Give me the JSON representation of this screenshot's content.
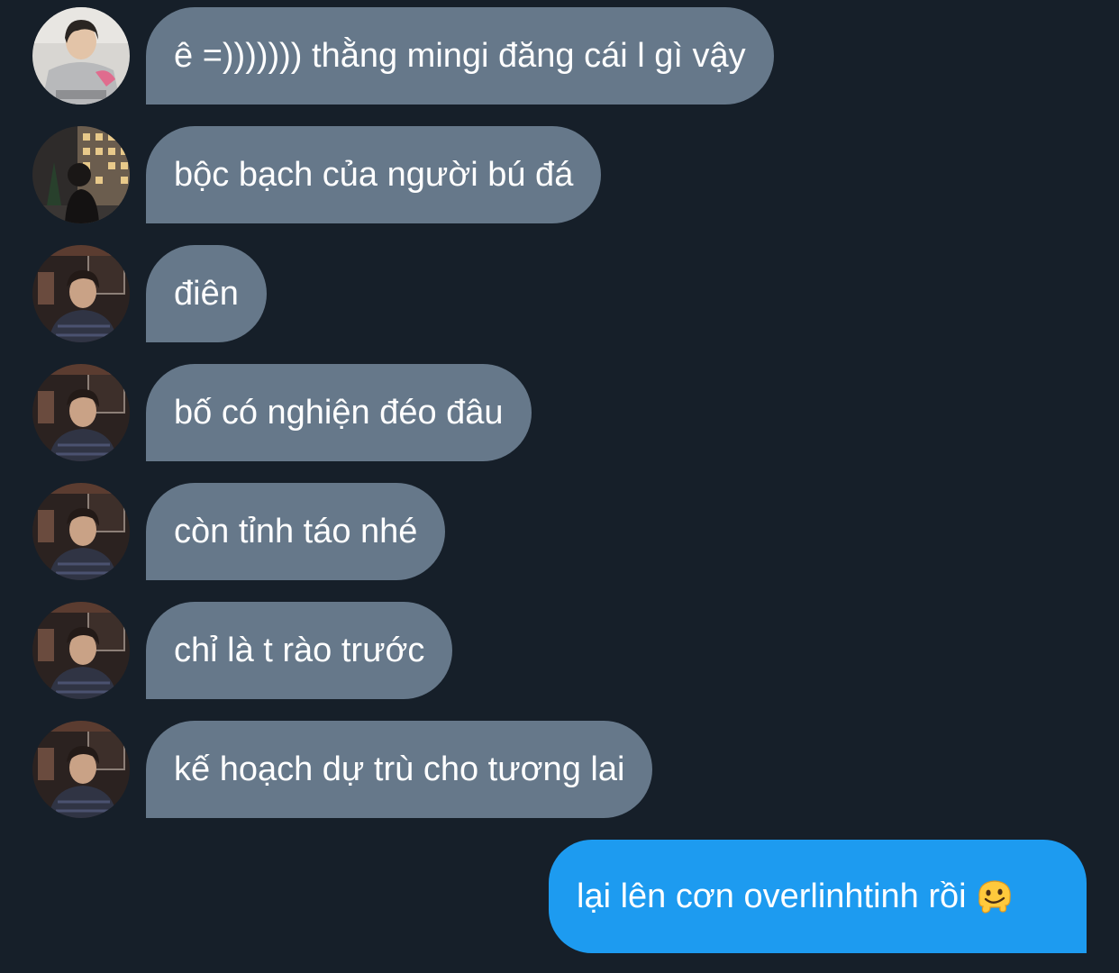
{
  "chat": {
    "messages": [
      {
        "sender": "other",
        "avatar": "avatar-hoodie",
        "text": "ê =))))))) thằng mingi đăng cái l gì vậy"
      },
      {
        "sender": "other",
        "avatar": "avatar-night-street",
        "text": "bộc bạch của người bú đá"
      },
      {
        "sender": "other",
        "avatar": "avatar-bar",
        "text": "điên"
      },
      {
        "sender": "other",
        "avatar": "avatar-bar",
        "text": "bố có nghiện đéo đâu"
      },
      {
        "sender": "other",
        "avatar": "avatar-bar",
        "text": "còn tỉnh táo nhé"
      },
      {
        "sender": "other",
        "avatar": "avatar-bar",
        "text": "chỉ là t rào trước"
      },
      {
        "sender": "other",
        "avatar": "avatar-bar",
        "text": "kế hoạch dự trù cho tương lai"
      }
    ],
    "outgoing": {
      "text": "lại lên cơn overlinhtinh rồi",
      "emoji": "melting-face-emoji"
    }
  },
  "colors": {
    "background": "#161f29",
    "incoming_bubble": "#66788a",
    "outgoing_bubble": "#1d9bf0"
  }
}
